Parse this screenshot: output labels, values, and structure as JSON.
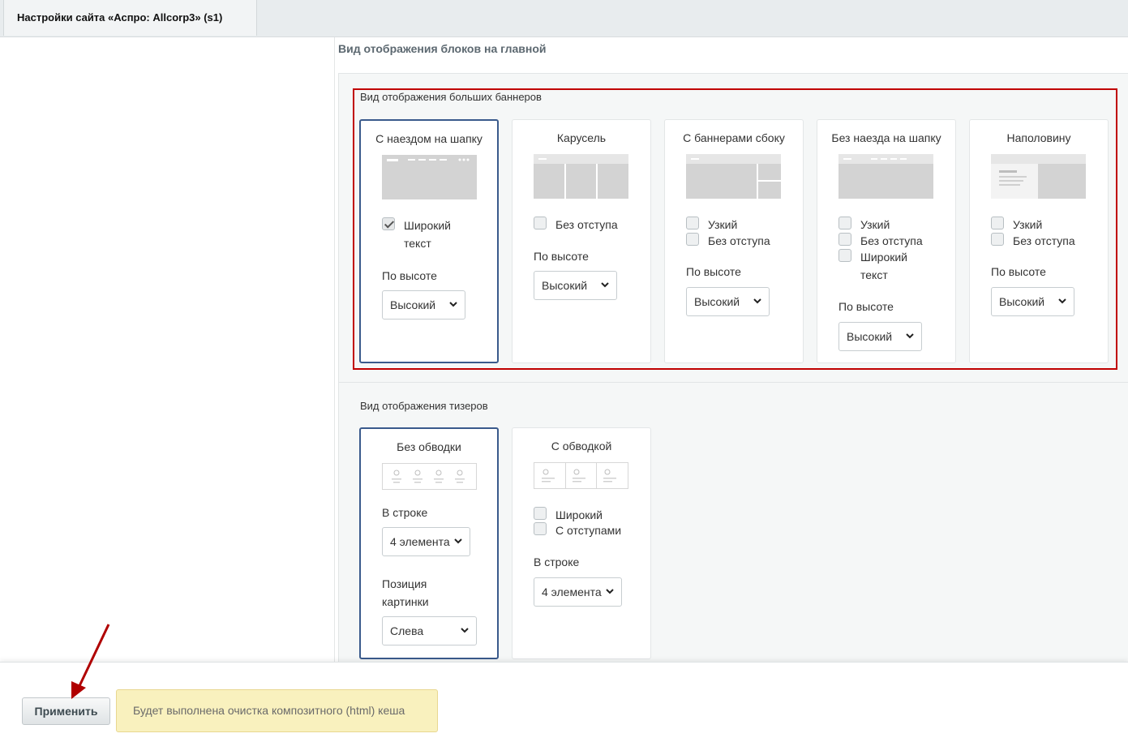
{
  "tab": {
    "title": "Настройки сайта «Аспро: Allcorp3» (s1)"
  },
  "section_title": "Вид отображения блоков на главной",
  "banners": {
    "title": "Вид отображения больших баннеров",
    "cards": [
      {
        "title": "С наездом на шапку",
        "checkboxes": [
          {
            "label_line1": "Широкий",
            "label_line2": "текст",
            "checked": true
          }
        ],
        "height_label": "По высоте",
        "height_value": "Высокий"
      },
      {
        "title": "Карусель",
        "checkboxes": [
          {
            "label": "Без отступа",
            "checked": false
          }
        ],
        "height_label": "По высоте",
        "height_value": "Высокий"
      },
      {
        "title": "С баннерами сбоку",
        "checkboxes": [
          {
            "label": "Узкий",
            "checked": false
          },
          {
            "label": "Без отступа",
            "checked": false
          }
        ],
        "height_label": "По высоте",
        "height_value": "Высокий"
      },
      {
        "title": "Без наезда на шапку",
        "checkboxes": [
          {
            "label": "Узкий",
            "checked": false
          },
          {
            "label": "Без отступа",
            "checked": false
          },
          {
            "label_line1": "Широкий",
            "label_line2": "текст",
            "checked": false
          }
        ],
        "height_label": "По высоте",
        "height_value": "Высокий"
      },
      {
        "title": "Наполовину",
        "checkboxes": [
          {
            "label": "Узкий",
            "checked": false
          },
          {
            "label": "Без отступа",
            "checked": false
          }
        ],
        "height_label": "По высоте",
        "height_value": "Высокий"
      }
    ]
  },
  "teasers": {
    "title": "Вид отображения тизеров",
    "cards": [
      {
        "title": "Без обводки",
        "row_label": "В строке",
        "row_value": "4 элемента",
        "pos_label_line1": "Позиция",
        "pos_label_line2": "картинки",
        "pos_value": "Слева"
      },
      {
        "title": "С обводкой",
        "checkboxes": [
          {
            "label": "Широкий",
            "checked": false
          },
          {
            "label": "С отступами",
            "checked": false
          }
        ],
        "row_label": "В строке",
        "row_value": "4 элемента"
      }
    ]
  },
  "footer": {
    "apply_label": "Применить",
    "notice": "Будет выполнена очистка композитного (html) кеша"
  },
  "colors": {
    "highlight": "#c00000",
    "active_border": "#3a5a8c",
    "notice_bg": "#f9f1be",
    "arrow": "#b00000"
  }
}
